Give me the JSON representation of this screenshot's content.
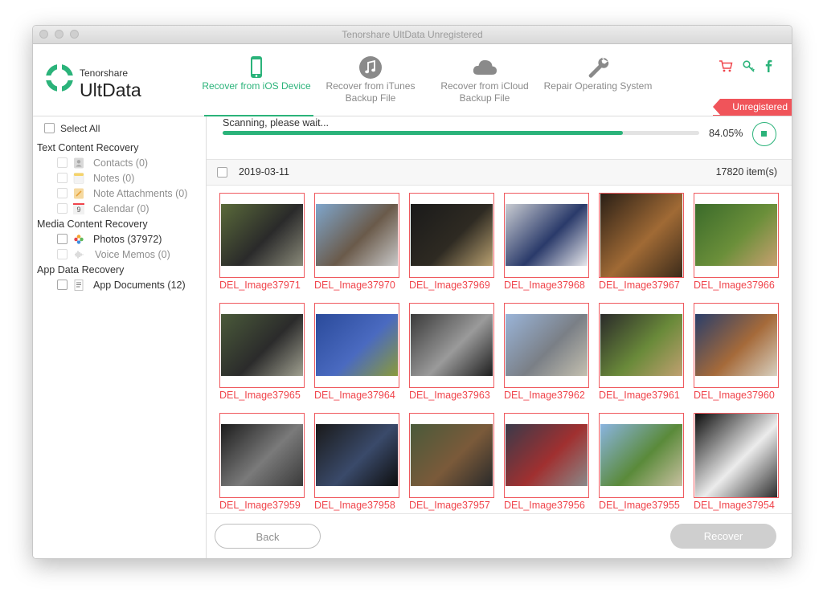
{
  "window": {
    "title": "Tenorshare UltData Unregistered"
  },
  "brand": {
    "company": "Tenorshare",
    "product": "UltData"
  },
  "nav": [
    {
      "label": "Recover from iOS Device",
      "icon": "phone-icon",
      "active": true
    },
    {
      "label": "Recover from iTunes Backup File",
      "icon": "itunes-icon",
      "active": false
    },
    {
      "label": "Recover from iCloud Backup File",
      "icon": "cloud-icon",
      "active": false
    },
    {
      "label": "Repair Operating System",
      "icon": "wrench-icon",
      "active": false
    }
  ],
  "header_icons": [
    "cart-icon",
    "key-icon",
    "facebook-icon"
  ],
  "badge": "Unregistered",
  "sidebar": {
    "select_all": "Select All",
    "groups": [
      {
        "title": "Text Content Recovery",
        "items": [
          {
            "label": "Contacts (0)",
            "icon": "contacts-icon",
            "enabled": false
          },
          {
            "label": "Notes (0)",
            "icon": "notes-icon",
            "enabled": false
          },
          {
            "label": "Note Attachments (0)",
            "icon": "note-attachments-icon",
            "enabled": false
          },
          {
            "label": "Calendar (0)",
            "icon": "calendar-icon",
            "enabled": false,
            "icon_text": "9"
          }
        ]
      },
      {
        "title": "Media Content Recovery",
        "items": [
          {
            "label": "Photos (37972)",
            "icon": "photos-icon",
            "enabled": true
          },
          {
            "label": "Voice Memos (0)",
            "icon": "voice-memos-icon",
            "enabled": false
          }
        ]
      },
      {
        "title": "App Data Recovery",
        "items": [
          {
            "label": "App Documents (12)",
            "icon": "app-documents-icon",
            "enabled": true
          }
        ]
      }
    ]
  },
  "scan": {
    "status": "Scanning, please wait...",
    "progress": 84.05,
    "percent_text": "84.05%"
  },
  "list": {
    "date": "2019-03-11",
    "count": "17820 item(s)",
    "items": [
      {
        "name": "DEL_Image37971",
        "colors": [
          "#5a6a3a",
          "#2a2a2a",
          "#8a8a7a"
        ]
      },
      {
        "name": "DEL_Image37970",
        "colors": [
          "#7fa6cc",
          "#6a5a4a",
          "#c8c8c8"
        ]
      },
      {
        "name": "DEL_Image37969",
        "colors": [
          "#1a1a1a",
          "#2e2a22",
          "#b8a070"
        ]
      },
      {
        "name": "DEL_Image37968",
        "colors": [
          "#c9ccd2",
          "#2a3a6a",
          "#e8e8ec"
        ]
      },
      {
        "name": "DEL_Image37967",
        "colors": [
          "#2a1f16",
          "#a06a35",
          "#3a2a1a"
        ]
      },
      {
        "name": "DEL_Image37966",
        "colors": [
          "#3a6a2a",
          "#6b8f3a",
          "#c8a070"
        ]
      },
      {
        "name": "DEL_Image37965",
        "colors": [
          "#4a5a3a",
          "#2b2b2b",
          "#a0a090"
        ]
      },
      {
        "name": "DEL_Image37964",
        "colors": [
          "#2a4a9a",
          "#4a6ac0",
          "#8a9a3a"
        ]
      },
      {
        "name": "DEL_Image37963",
        "colors": [
          "#3a3a3a",
          "#9a9a9a",
          "#1e1e1e"
        ]
      },
      {
        "name": "DEL_Image37962",
        "colors": [
          "#9ab4d8",
          "#7a7f86",
          "#c4c0b0"
        ]
      },
      {
        "name": "DEL_Image37961",
        "colors": [
          "#2a2a2a",
          "#6a8a3a",
          "#c0a070"
        ]
      },
      {
        "name": "DEL_Image37960",
        "colors": [
          "#2a3e6a",
          "#a56a3a",
          "#d8d0c0"
        ]
      },
      {
        "name": "DEL_Image37959",
        "colors": [
          "#1c1c1c",
          "#7a7a7a",
          "#3a3a3a"
        ]
      },
      {
        "name": "DEL_Image37958",
        "colors": [
          "#1a1a1a",
          "#3a4a6a",
          "#0e0e0e"
        ]
      },
      {
        "name": "DEL_Image37957",
        "colors": [
          "#4a5a3a",
          "#7a5a3a",
          "#2a2a2a"
        ]
      },
      {
        "name": "DEL_Image37956",
        "colors": [
          "#3a3a4a",
          "#a03030",
          "#8a8a8a"
        ]
      },
      {
        "name": "DEL_Image37955",
        "colors": [
          "#8ab4e0",
          "#5a8a3a",
          "#c8c0a0"
        ]
      },
      {
        "name": "DEL_Image37954",
        "colors": [
          "#0e0e0e",
          "#ececec",
          "#2a2a2a"
        ]
      }
    ]
  },
  "footer": {
    "back": "Back",
    "recover": "Recover"
  },
  "colors": {
    "accent": "#2bb37a",
    "deleted": "#f0454c",
    "badge": "#f0545a"
  }
}
